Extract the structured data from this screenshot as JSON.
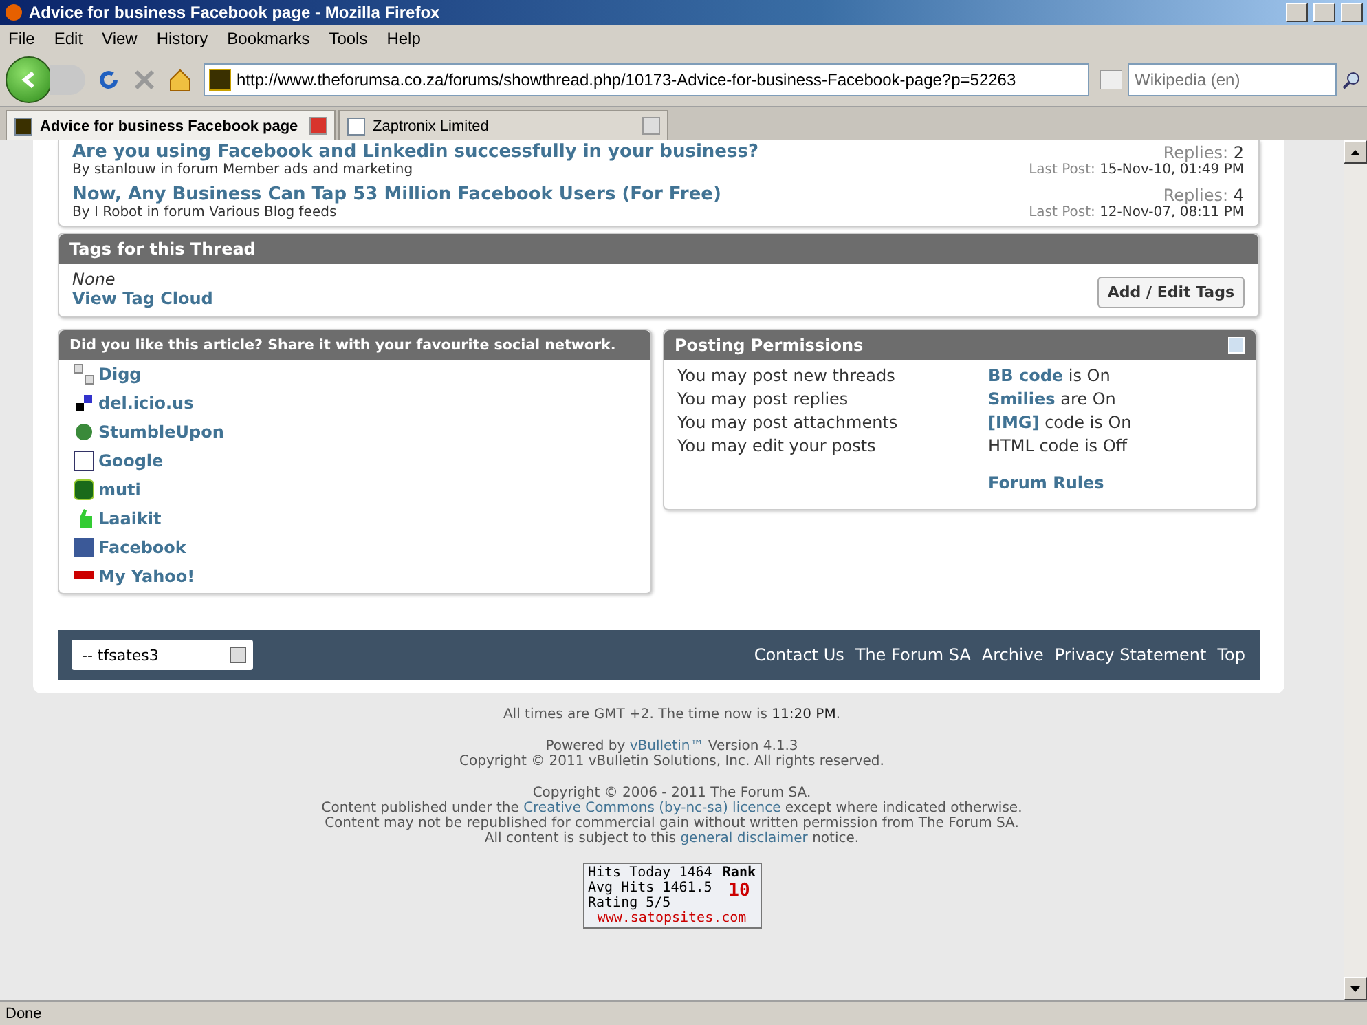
{
  "window": {
    "title": "Advice for business Facebook page - Mozilla Firefox"
  },
  "menu": [
    "File",
    "Edit",
    "View",
    "History",
    "Bookmarks",
    "Tools",
    "Help"
  ],
  "toolbar": {
    "url": "http://www.theforumsa.co.za/forums/showthread.php/10173-Advice-for-business-Facebook-page?p=52263",
    "search_placeholder": "Wikipedia (en)"
  },
  "tabs": [
    {
      "label": "Advice for business Facebook page",
      "selected": true
    },
    {
      "label": "Zaptronix Limited",
      "selected": false
    }
  ],
  "similar_threads": [
    {
      "title": "Are you using Facebook and Linkedin successfully in your business?",
      "byline": "By stanlouw in forum Member ads and marketing",
      "replies_label": "Replies:",
      "replies": "2",
      "last_post_label": "Last Post:",
      "last_post": "15-Nov-10, 01:49 PM"
    },
    {
      "title": "Now, Any Business Can Tap 53 Million Facebook Users (For Free)",
      "byline": "By I Robot in forum Various Blog feeds",
      "replies_label": "Replies:",
      "replies": "4",
      "last_post_label": "Last Post:",
      "last_post": "12-Nov-07, 08:11 PM"
    }
  ],
  "tags": {
    "title": "Tags for this Thread",
    "none": "None",
    "cloud_link": "View Tag Cloud",
    "button": "Add / Edit Tags"
  },
  "share": {
    "title": "Did you like this article? Share it with your favourite social network.",
    "items": [
      {
        "label": "Digg",
        "kind": "digg"
      },
      {
        "label": "del.icio.us",
        "kind": "delicious"
      },
      {
        "label": "StumbleUpon",
        "kind": "stumble"
      },
      {
        "label": "Google",
        "kind": "google"
      },
      {
        "label": "muti",
        "kind": "muti"
      },
      {
        "label": "Laaikit",
        "kind": "laaikit"
      },
      {
        "label": "Facebook",
        "kind": "facebook"
      },
      {
        "label": "My Yahoo!",
        "kind": "yahoo"
      }
    ]
  },
  "permissions": {
    "title": "Posting Permissions",
    "rules": [
      "You may post new threads",
      "You may post replies",
      "You may post attachments",
      "You may edit your posts"
    ],
    "settings": [
      {
        "link": "BB code",
        "text": "is On"
      },
      {
        "link": "Smilies",
        "text": "are On"
      },
      {
        "link": "[IMG]",
        "text": "code is On"
      },
      {
        "text": "HTML code is Off"
      }
    ],
    "forum_rules": "Forum Rules"
  },
  "footer": {
    "style_select": "-- tfsates3",
    "links": [
      "Contact Us",
      "The Forum SA",
      "Archive",
      "Privacy Statement",
      "Top"
    ]
  },
  "notes": [
    [
      {
        "t": "All times are GMT +2. The time now is "
      },
      {
        "t": "11:20 PM",
        "strong": true
      },
      {
        "t": "."
      }
    ],
    [
      {
        "t": "Powered by "
      },
      {
        "t": "vBulletin™",
        "link": true
      },
      {
        "t": " Version 4.1.3"
      }
    ],
    [
      {
        "t": "Copyright © 2011 vBulletin Solutions, Inc. All rights reserved."
      }
    ],
    [
      {
        "t": "Copyright © 2006 - 2011 The Forum SA."
      }
    ],
    [
      {
        "t": "Content published under the "
      },
      {
        "t": "Creative Commons (by-nc-sa) licence",
        "link": true
      },
      {
        "t": " except where indicated otherwise."
      }
    ],
    [
      {
        "t": "Content may not be republished for commercial gain without written permission from The Forum SA."
      }
    ],
    [
      {
        "t": "All content is subject to this "
      },
      {
        "t": "general disclaimer",
        "link": true
      },
      {
        "t": " notice."
      }
    ]
  ],
  "counter": {
    "lines": [
      "Hits Today 1464",
      "Avg Hits 1461.5",
      "Rating 5/5"
    ],
    "rank_label": "Rank",
    "rank": "10",
    "site": "www.satopsites.com"
  },
  "status_bar": "Done"
}
